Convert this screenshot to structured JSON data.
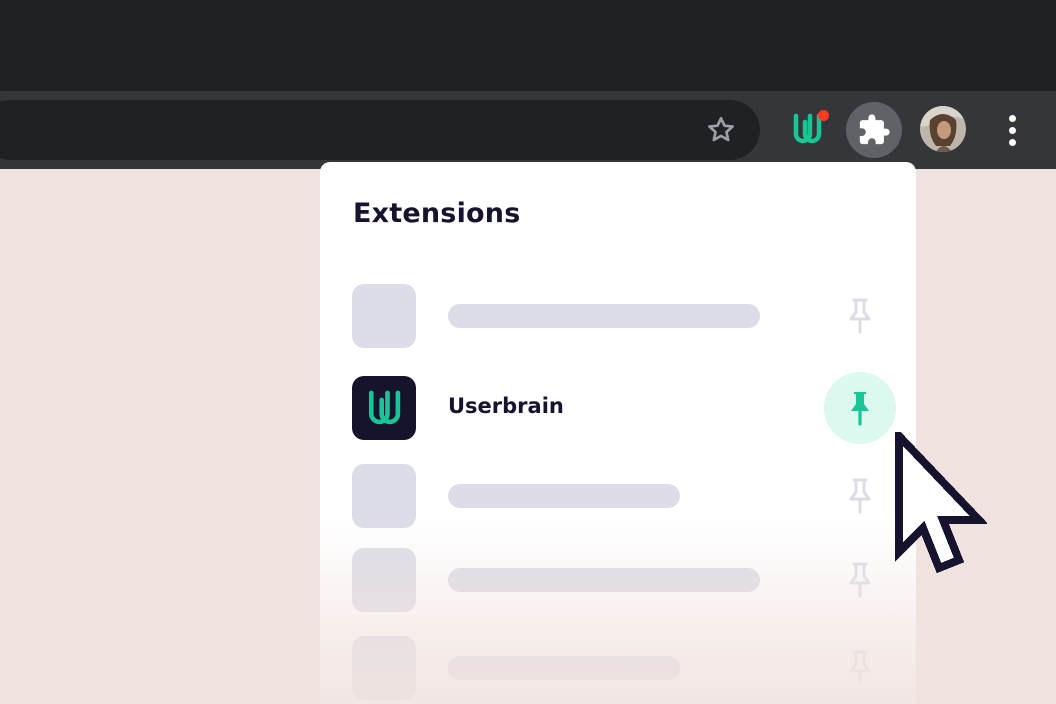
{
  "browser": {
    "colors": {
      "titlebar": "#202124",
      "toolbar": "#35363a",
      "active_button": "#5f6368"
    },
    "toolbar_icons": [
      "star-icon",
      "userbrain-extension-icon",
      "puzzle-icon",
      "avatar",
      "kebab-menu-icon"
    ],
    "notification_dot_color": "#ff3b1f"
  },
  "extensions_panel": {
    "title": "Extensions",
    "items": [
      {
        "kind": "placeholder",
        "pinned": false
      },
      {
        "kind": "extension",
        "name": "Userbrain",
        "pinned": true,
        "accent": "#17c595"
      },
      {
        "kind": "placeholder",
        "pinned": false
      },
      {
        "kind": "placeholder",
        "pinned": false
      },
      {
        "kind": "placeholder",
        "pinned": false
      }
    ]
  },
  "colors": {
    "page_background": "#f0e3df",
    "placeholder": "#dcdce7",
    "pin_active": "#17c595",
    "pin_highlight": "#dcf9ef",
    "text_dark": "#15132e"
  }
}
